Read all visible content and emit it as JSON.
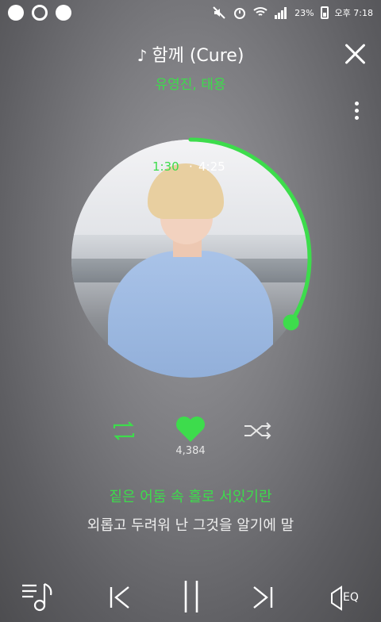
{
  "status_bar": {
    "battery_percent": "23%",
    "time": "오후 7:18",
    "icons": [
      "notification-app-icon",
      "sync-icon",
      "messenger-icon",
      "mute-icon",
      "alarm-icon",
      "wifi-icon",
      "signal-icon",
      "battery-icon"
    ]
  },
  "header": {
    "title": "함께 (Cure)",
    "artist": "유영진, 태용"
  },
  "player": {
    "current_time": "1:30",
    "separator": "·",
    "total_time": "4:25",
    "progress_fraction": 0.34,
    "accent_color": "#3ddc4c"
  },
  "controls": {
    "like_count": "4,384",
    "repeat_icon": "repeat-icon",
    "like_icon": "heart-icon",
    "shuffle_icon": "shuffle-icon"
  },
  "lyrics": {
    "current": "짙은 어둠 속 홀로 서있기란",
    "next": "외롭고 두려워 난 그것을 알기에 말"
  },
  "bottom_bar": {
    "eq_label": "EQ",
    "icons": [
      "playlist-icon",
      "previous-icon",
      "pause-icon",
      "next-icon",
      "equalizer-icon"
    ]
  }
}
